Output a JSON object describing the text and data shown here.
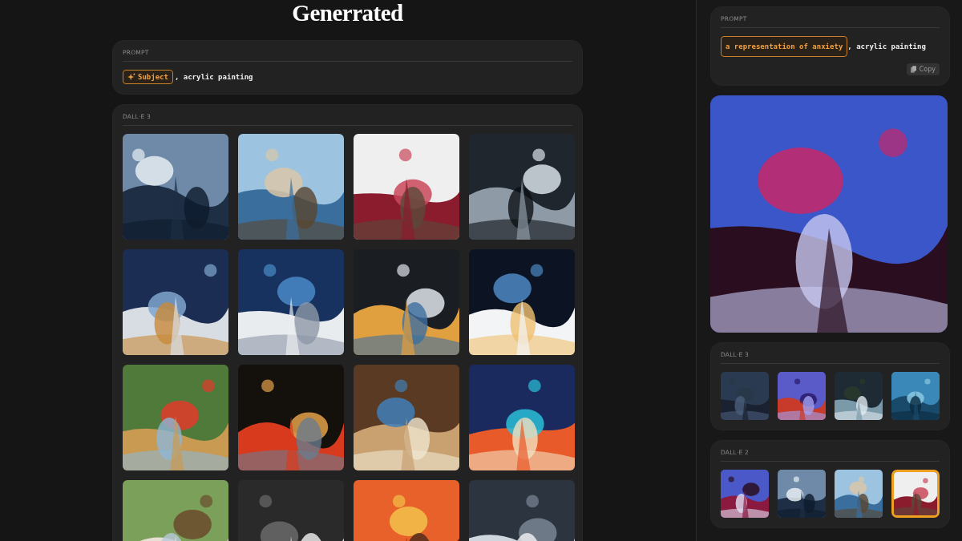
{
  "title": "Generrated",
  "prompt": {
    "label": "PROMPT",
    "chip": "Subject",
    "rest": ", acrylic painting"
  },
  "gallery": {
    "label": "DALL·E 3",
    "images": [
      {
        "kind": "picture"
      },
      {
        "kind": "picture"
      },
      {
        "kind": "picture"
      },
      {
        "kind": "picture"
      },
      {
        "kind": "picture"
      },
      {
        "kind": "picture"
      },
      {
        "kind": "picture"
      },
      {
        "kind": "picture"
      },
      {
        "kind": "picture"
      },
      {
        "kind": "picture"
      },
      {
        "kind": "picture"
      },
      {
        "kind": "picture"
      },
      {
        "kind": "picture"
      },
      {
        "kind": "picture"
      },
      {
        "kind": "picture"
      },
      {
        "kind": "picture"
      }
    ]
  },
  "detail": {
    "prompt_label": "PROMPT",
    "chip": "a representation of anxiety",
    "rest": ", acrylic painting",
    "copy_button": "Copy",
    "preview": {
      "kind": "picture"
    },
    "groups": [
      {
        "label": "DALL·E 3",
        "thumbs": [
          {
            "kind": "picture",
            "selected": false
          },
          {
            "kind": "picture",
            "selected": false
          },
          {
            "kind": "picture",
            "selected": false
          },
          {
            "kind": "picture",
            "selected": false
          }
        ]
      },
      {
        "label": "DALL·E 2",
        "thumbs": [
          {
            "kind": "picture",
            "selected": false
          },
          {
            "kind": "picture",
            "selected": false
          },
          {
            "kind": "picture",
            "selected": false
          },
          {
            "kind": "picture",
            "selected": true
          }
        ]
      }
    ]
  }
}
